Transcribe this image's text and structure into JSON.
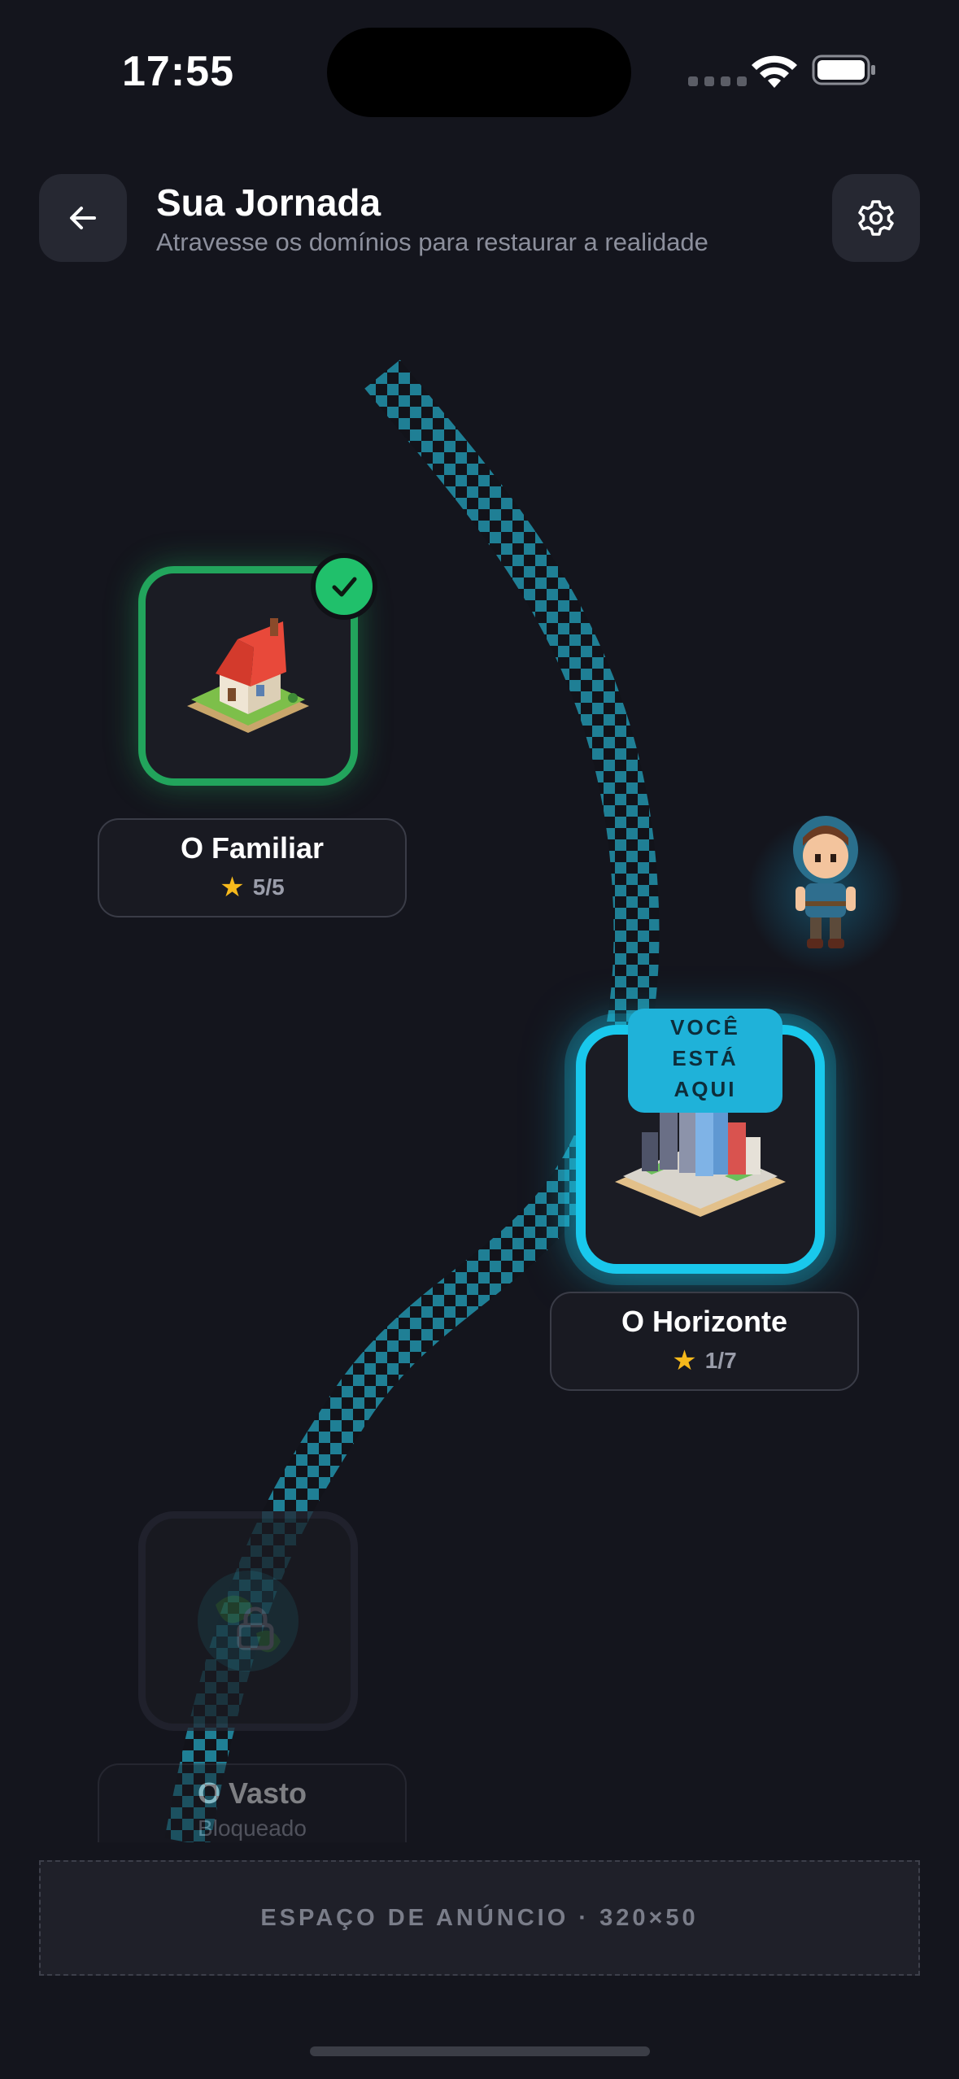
{
  "status": {
    "time": "17:55"
  },
  "header": {
    "title": "Sua Jornada",
    "subtitle": "Atravesse os domínios para restaurar a realidade"
  },
  "levels": [
    {
      "name": "O Familiar",
      "stars": "5/5",
      "state": "completed"
    },
    {
      "name": "O Horizonte",
      "stars": "1/7",
      "state": "current"
    },
    {
      "name": "O Vasto",
      "status": "Bloqueado",
      "state": "locked"
    }
  ],
  "current_marker": {
    "line1": "VOCÊ",
    "line2": "ESTÁ",
    "line3": "AQUI"
  },
  "ad": {
    "label": "ESPAÇO DE ANÚNCIO · 320×50"
  },
  "colors": {
    "background": "#14151d",
    "completed": "#22a45c",
    "current": "#19c8ec",
    "star": "#f6b91c",
    "path": "#1f7f95"
  },
  "icons": {
    "back": "arrow-left-icon",
    "settings": "gear-icon",
    "check": "check-icon",
    "lock": "lock-icon",
    "star": "star-icon"
  }
}
